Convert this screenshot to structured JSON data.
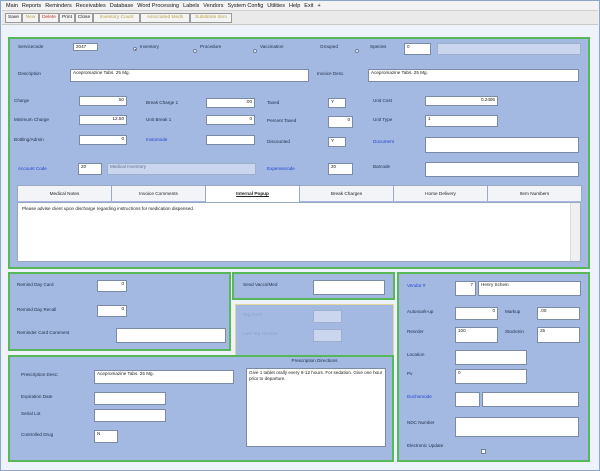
{
  "menu": [
    "Main",
    "Reports",
    "Reminders",
    "Receivables",
    "Database",
    "Word Processing",
    "Labels",
    "Vendors",
    "System Config",
    "Utilities",
    "Help",
    "Exit",
    "+"
  ],
  "toolbar": {
    "save": "Save",
    "new": "New",
    "delete": "Delete",
    "print": "Print",
    "close": "Close",
    "inventory_count": "Inventory Count",
    "associated_meds": "Associated Meds",
    "substitute_item": "Substitute Item"
  },
  "service": {
    "servicecode_label": "Servicecode",
    "servicecode": "2047",
    "type_inventory": "Inventory",
    "type_procedure": "Procedure",
    "type_vaccination": "Vaccination",
    "type_grouped": "Grouped",
    "species_label": "Species",
    "species": "0",
    "description_label": "Description",
    "description": "Acepromazine Tabs. 25 Mg.",
    "invoice_desc_label": "Invoice Desc.",
    "invoice_desc": "Acepromazine Tabs. 25 Mg.",
    "charge_label": "Charge",
    "charge": "50",
    "minimum_charge_label": "Minimum Charge",
    "minimum_charge": "12.50",
    "bottling_label": "Bottling/Admin",
    "bottling": "0",
    "break_charge_label": "Break Charge 1",
    "break_charge": ".00",
    "unit_break_label": "Unit Break 1",
    "unit_break": "0",
    "invtomode_label": "Invtomode",
    "invtomode": "",
    "taxed_label": "Taxed",
    "taxed": "Y",
    "percent_taxed_label": "Percent Taxed",
    "percent_taxed": "0",
    "discounted_label": "Discounted",
    "discounted": "Y",
    "unit_cost_label": "Unit Cost",
    "unit_cost": "0.2406",
    "unit_type_label": "Unit Type",
    "unit_type": "1",
    "document_label": "Document",
    "document": "",
    "account_code_label": "Account Code",
    "account_code": "20",
    "account_name": "Medical Inventory",
    "expensecode_label": "Expensecode",
    "expensecode": "20",
    "barcode_label": "Barcode",
    "barcode": ""
  },
  "tabs": [
    "Medical Notes",
    "Invoice Comments",
    "Internal Popup",
    "Break Charges",
    "Home Delivery",
    "Item Numbers"
  ],
  "notes_text": "Please advise client upon discharge regarding instructions for medication dispensed.",
  "reminders": {
    "rdc_label": "Remind Day Card",
    "rdc": "0",
    "rdr_label": "Remind Day Recall",
    "rdr": "0",
    "rcc_label": "Reminder Card Comment",
    "rcc": ""
  },
  "vaccine": {
    "sendvm_label": "Send Vaccs/Med",
    "sendvm": "",
    "tag_format_label": "Tag Form",
    "tag_format": "",
    "last_tag_label": "Last Tag Number",
    "last_tag": ""
  },
  "vendor": {
    "vendor_label": "Vendor #",
    "vendor_num": "7",
    "vendor_name": "Henry Schein",
    "automarkup_label": "Automark-up",
    "automarkup": "0",
    "markup_label": "Markup",
    "markup": ".00",
    "reorder_label": "Reorder",
    "reorder": "100",
    "stock_label": "Stockmin",
    "stock": "25",
    "location_label": "Location",
    "location": "",
    "pv_label": "Pv",
    "pv": "0",
    "dochomode_label": "Dochomode",
    "dochomode": "",
    "ndc_label": "NDC Number",
    "ndc": "",
    "electronic_label": "Electronic Update"
  },
  "prescription": {
    "title": "Prescription Directions",
    "desc_label": "Prescription Desc:",
    "desc": "Acepromazine Tabs. 25 Mg.",
    "expiration_label": "Expiration Date",
    "expiration": "",
    "serial_label": "Serial Lot",
    "serial": "",
    "controlled_label": "Controlled Drug",
    "controlled": "N",
    "directions": "Give 1 tablet orally every 8-12 hours. For sedation. Give one hour prior to departure."
  }
}
